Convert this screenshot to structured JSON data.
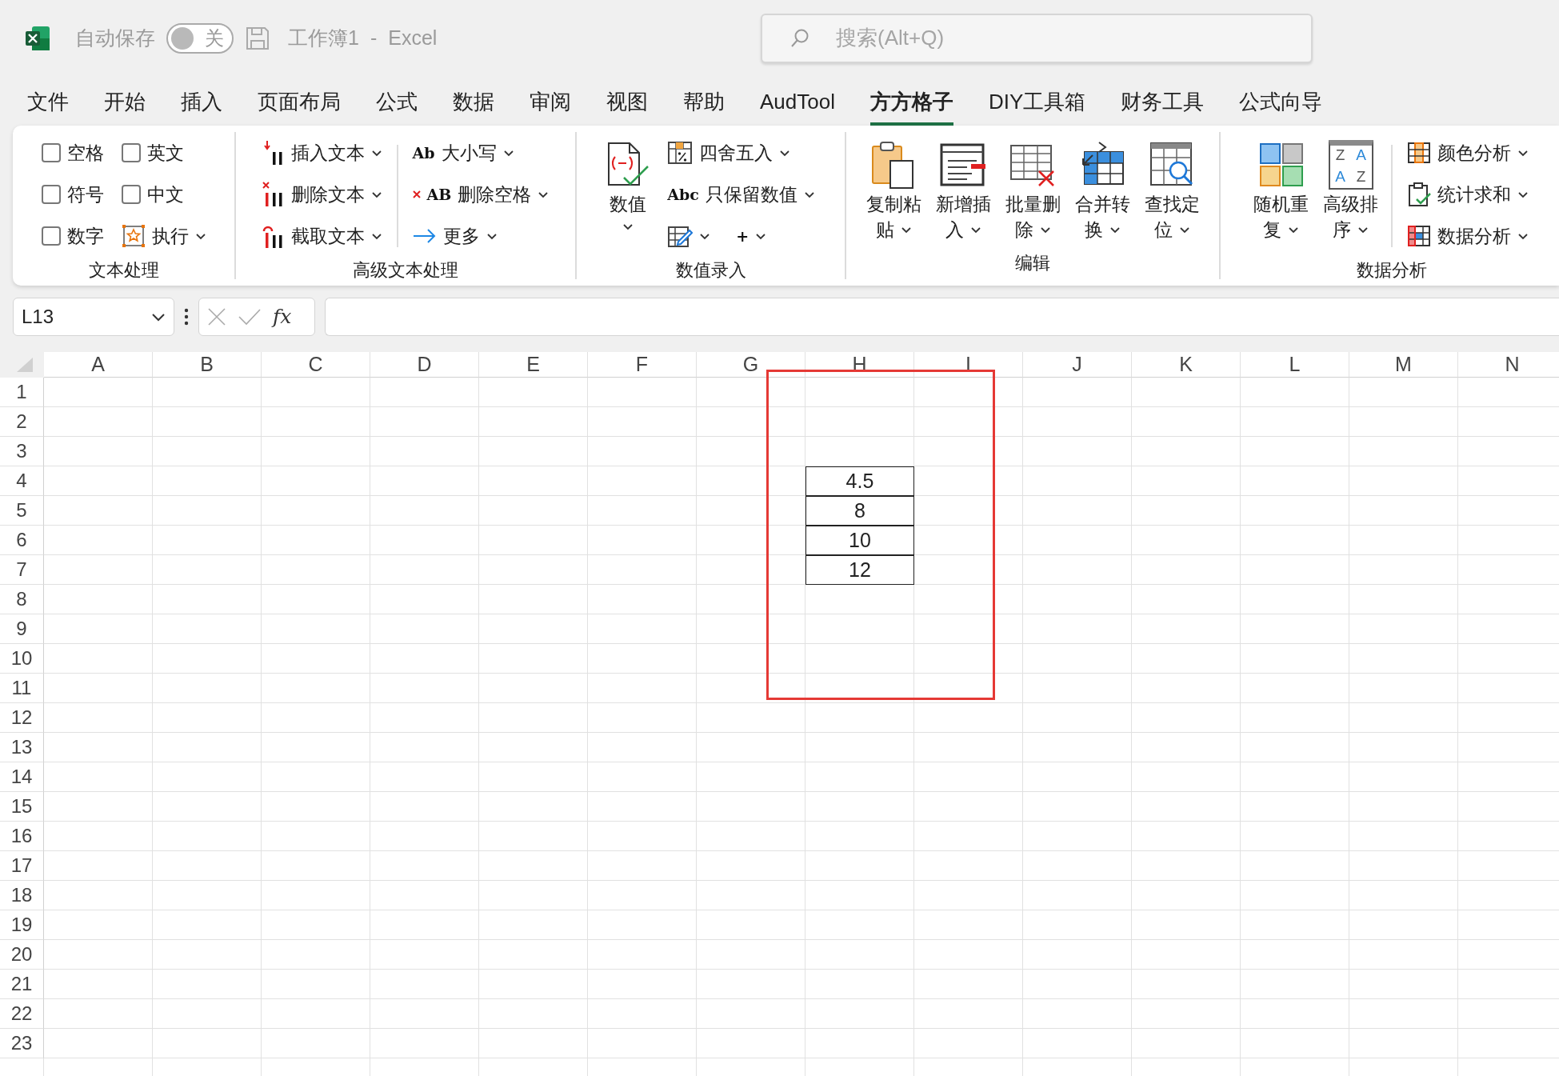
{
  "title_bar": {
    "autosave_label": "自动保存",
    "autosave_toggle": {
      "label": "关",
      "on": false
    },
    "document_title": "工作簿1",
    "separator": "-",
    "app_name": "Excel",
    "search": {
      "placeholder": "搜索(Alt+Q)"
    }
  },
  "menu_tabs": [
    {
      "label": "文件",
      "selected": false
    },
    {
      "label": "开始",
      "selected": false
    },
    {
      "label": "插入",
      "selected": false
    },
    {
      "label": "页面布局",
      "selected": false
    },
    {
      "label": "公式",
      "selected": false
    },
    {
      "label": "数据",
      "selected": false
    },
    {
      "label": "审阅",
      "selected": false
    },
    {
      "label": "视图",
      "selected": false
    },
    {
      "label": "帮助",
      "selected": false
    },
    {
      "label": "AudTool",
      "selected": false
    },
    {
      "label": "方方格子",
      "selected": true
    },
    {
      "label": "DIY工具箱",
      "selected": false
    },
    {
      "label": "财务工具",
      "selected": false
    },
    {
      "label": "公式向导",
      "selected": false
    }
  ],
  "ribbon": {
    "groups": [
      {
        "label": "文本处理",
        "columns": [
          {
            "kind": "stack",
            "items": [
              {
                "kind": "checkbox",
                "label": "空格",
                "checked": false
              },
              {
                "kind": "checkbox",
                "label": "符号",
                "checked": false
              },
              {
                "kind": "checkbox",
                "label": "数字",
                "checked": false
              }
            ]
          },
          {
            "kind": "stack",
            "items": [
              {
                "kind": "checkbox",
                "label": "英文",
                "checked": false
              },
              {
                "kind": "checkbox",
                "label": "中文",
                "checked": false
              },
              {
                "kind": "button",
                "label": "执行",
                "dropdown": true
              }
            ]
          }
        ]
      },
      {
        "label": "高级文本处理",
        "columns": [
          {
            "kind": "stack",
            "items": [
              {
                "kind": "button",
                "label": "插入文本",
                "dropdown": true
              },
              {
                "kind": "button",
                "label": "删除文本",
                "dropdown": true
              },
              {
                "kind": "button",
                "label": "截取文本",
                "dropdown": true
              }
            ]
          },
          {
            "kind": "separator"
          },
          {
            "kind": "stack",
            "items": [
              {
                "kind": "button",
                "icon_text": "Ab",
                "label": "大小写",
                "dropdown": true
              },
              {
                "kind": "button",
                "icon_text": "AB",
                "label": "删除空格",
                "dropdown": true
              },
              {
                "kind": "button",
                "label": "更多",
                "dropdown": true
              }
            ]
          }
        ]
      },
      {
        "label": "数值录入",
        "columns": [
          {
            "kind": "large",
            "label_lines": [
              "数值"
            ],
            "dropdown": true
          },
          {
            "kind": "stack",
            "items": [
              {
                "kind": "button",
                "label": "四舍五入",
                "dropdown": true
              },
              {
                "kind": "button",
                "icon_text": "Abc",
                "label": "只保留数值",
                "dropdown": true
              },
              {
                "kind": "pair",
                "items": [
                  {
                    "kind": "icon_button",
                    "dropdown": true
                  },
                  {
                    "kind": "glyph_button",
                    "glyph": "+",
                    "dropdown": true
                  }
                ]
              }
            ]
          }
        ]
      },
      {
        "label": "编辑",
        "columns": [
          {
            "kind": "large",
            "label_lines": [
              "复制粘",
              "贴"
            ],
            "dropdown": true
          },
          {
            "kind": "large",
            "label_lines": [
              "新增插",
              "入"
            ],
            "dropdown": true
          },
          {
            "kind": "large",
            "label_lines": [
              "批量删",
              "除"
            ],
            "dropdown": true
          },
          {
            "kind": "large",
            "label_lines": [
              "合并转",
              "换"
            ],
            "dropdown": true
          },
          {
            "kind": "large",
            "label_lines": [
              "查找定",
              "位"
            ],
            "dropdown": true
          }
        ]
      },
      {
        "label": "数据分析",
        "columns": [
          {
            "kind": "large",
            "label_lines": [
              "随机重",
              "复"
            ],
            "dropdown": true
          },
          {
            "kind": "large",
            "icon_text": [
              "Z",
              "A",
              "A",
              "Z"
            ],
            "label_lines": [
              "高级排",
              "序"
            ],
            "dropdown": true
          },
          {
            "kind": "separator"
          },
          {
            "kind": "stack",
            "items": [
              {
                "kind": "button",
                "label": "颜色分析",
                "dropdown": true
              },
              {
                "kind": "button",
                "label": "统计求和",
                "dropdown": true
              },
              {
                "kind": "button",
                "label": "数据分析",
                "dropdown": true
              }
            ]
          }
        ]
      }
    ]
  },
  "formula_bar": {
    "name_box": "L13",
    "function_label": "fx"
  },
  "sheet": {
    "columns": [
      "A",
      "B",
      "C",
      "D",
      "E",
      "F",
      "G",
      "H",
      "I",
      "J",
      "K",
      "L",
      "M",
      "N"
    ],
    "rows": [
      {
        "label": "1"
      },
      {
        "label": "2"
      },
      {
        "label": "3"
      },
      {
        "label": "4",
        "cells": {
          "H": {
            "value": "4.5",
            "bordered": true
          }
        }
      },
      {
        "label": "5",
        "cells": {
          "H": {
            "value": "8",
            "bordered": true
          }
        }
      },
      {
        "label": "6",
        "cells": {
          "H": {
            "value": "10",
            "bordered": true
          }
        }
      },
      {
        "label": "7",
        "cells": {
          "H": {
            "value": "12",
            "bordered": true
          }
        }
      },
      {
        "label": "8"
      },
      {
        "label": "9"
      },
      {
        "label": "10"
      },
      {
        "label": "11"
      },
      {
        "label": "12"
      },
      {
        "label": "13"
      },
      {
        "label": "14"
      },
      {
        "label": "15"
      },
      {
        "label": "16"
      },
      {
        "label": "17"
      },
      {
        "label": "18"
      },
      {
        "label": "19"
      },
      {
        "label": "20"
      },
      {
        "label": "21"
      },
      {
        "label": "22"
      },
      {
        "label": "23"
      }
    ],
    "highlight_frame": true
  }
}
